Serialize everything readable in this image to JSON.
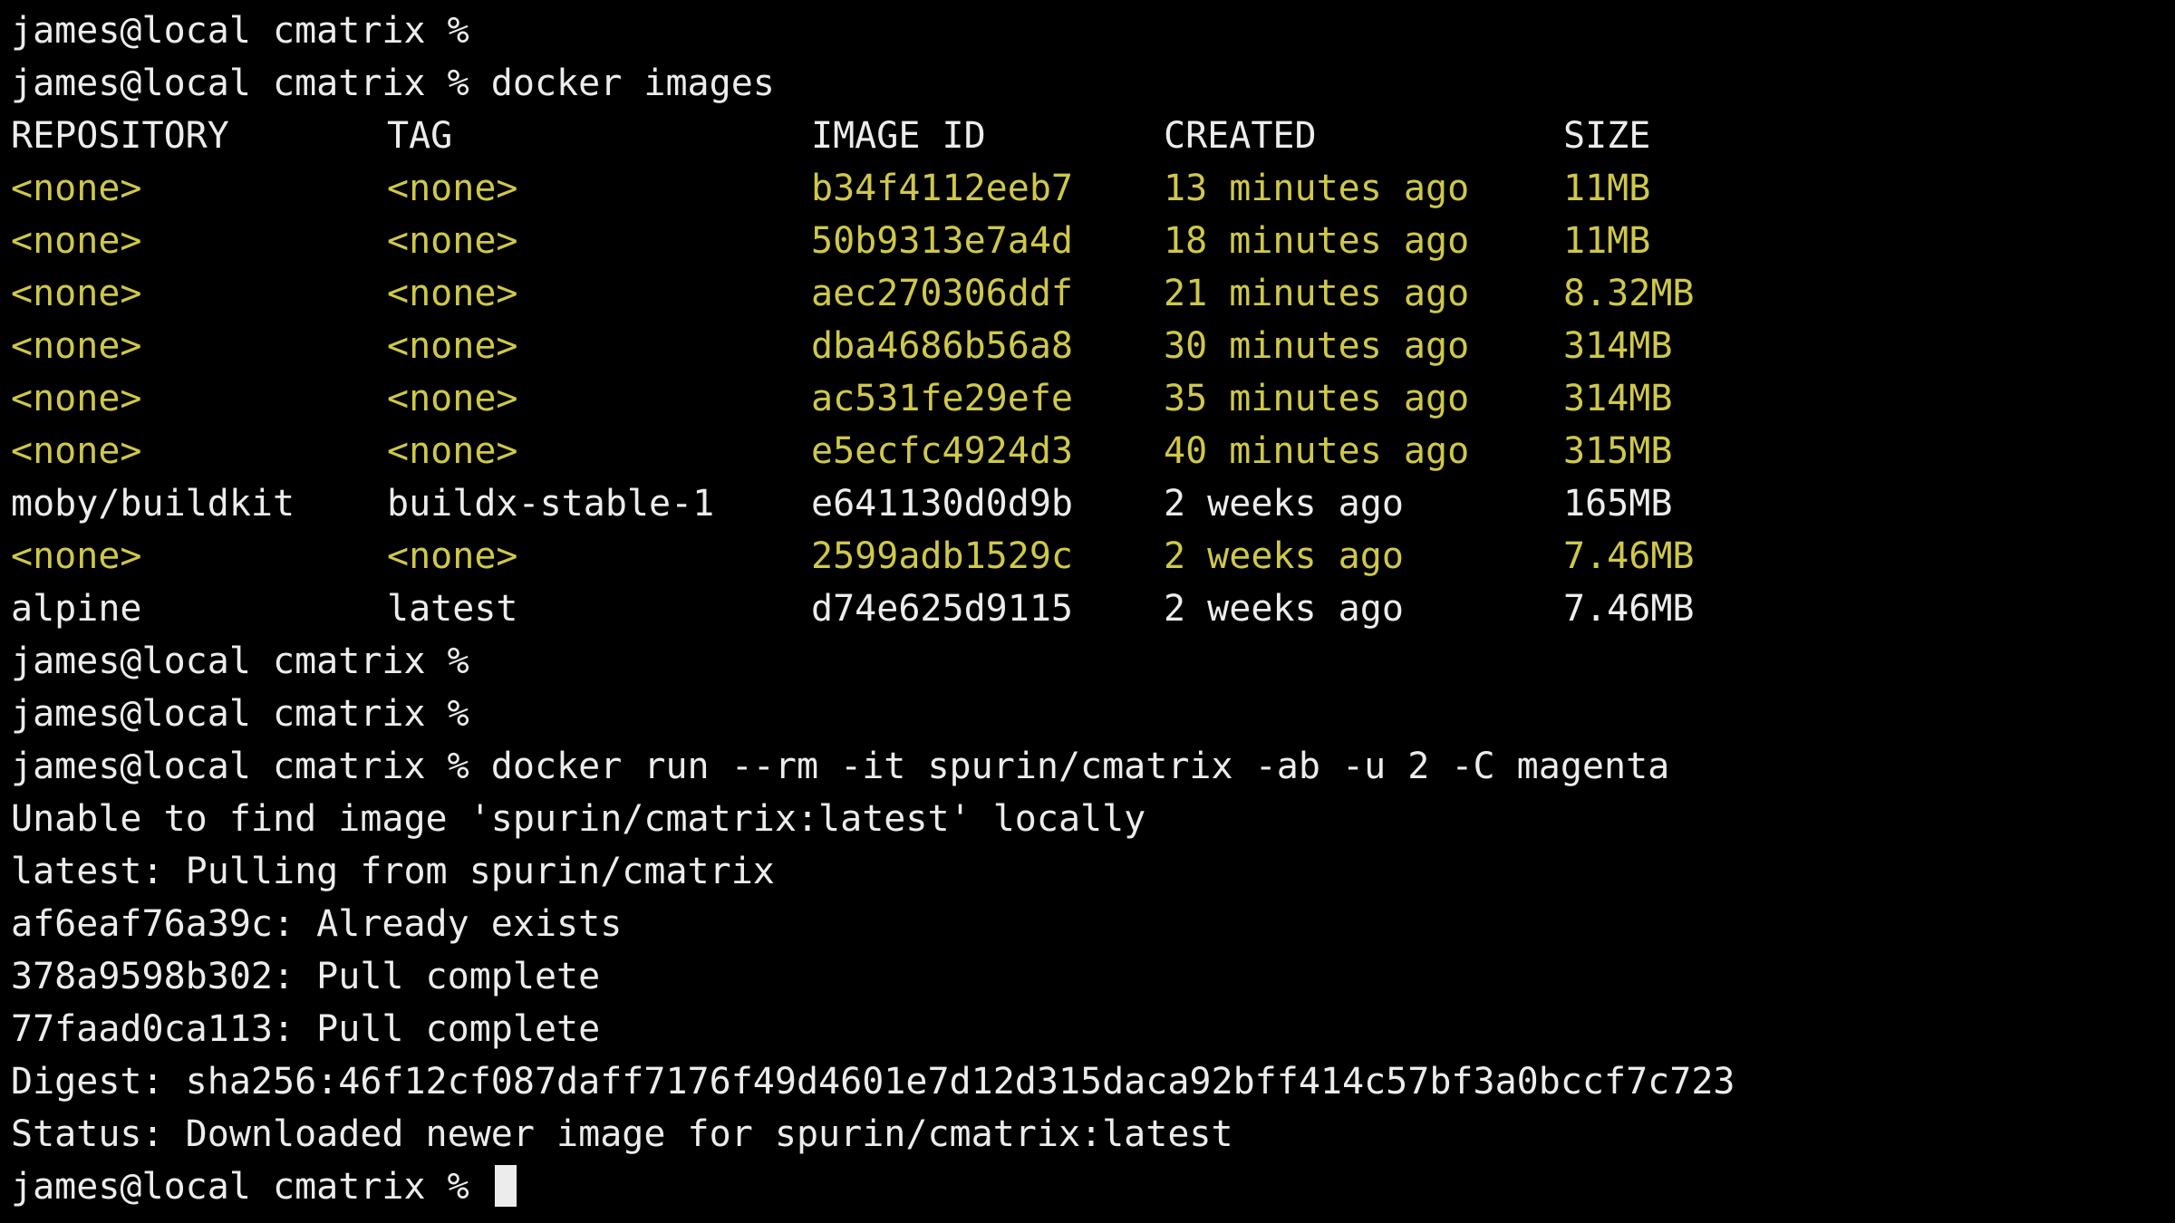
{
  "colors": {
    "background": "#000000",
    "text": "#ececec",
    "dangling_image": "#cfc84a"
  },
  "lines_before": [
    "james@local cmatrix %",
    "james@local cmatrix % docker images"
  ],
  "table": {
    "headers": [
      "REPOSITORY",
      "TAG",
      "IMAGE ID",
      "CREATED",
      "SIZE"
    ],
    "rows": [
      {
        "repository": "<none>",
        "tag": "<none>",
        "image_id": "b34f4112eeb7",
        "created": "13 minutes ago",
        "size": "11MB",
        "dangling": true
      },
      {
        "repository": "<none>",
        "tag": "<none>",
        "image_id": "50b9313e7a4d",
        "created": "18 minutes ago",
        "size": "11MB",
        "dangling": true
      },
      {
        "repository": "<none>",
        "tag": "<none>",
        "image_id": "aec270306ddf",
        "created": "21 minutes ago",
        "size": "8.32MB",
        "dangling": true
      },
      {
        "repository": "<none>",
        "tag": "<none>",
        "image_id": "dba4686b56a8",
        "created": "30 minutes ago",
        "size": "314MB",
        "dangling": true
      },
      {
        "repository": "<none>",
        "tag": "<none>",
        "image_id": "ac531fe29efe",
        "created": "35 minutes ago",
        "size": "314MB",
        "dangling": true
      },
      {
        "repository": "<none>",
        "tag": "<none>",
        "image_id": "e5ecfc4924d3",
        "created": "40 minutes ago",
        "size": "315MB",
        "dangling": true
      },
      {
        "repository": "moby/buildkit",
        "tag": "buildx-stable-1",
        "image_id": "e641130d0d9b",
        "created": "2 weeks ago",
        "size": "165MB",
        "dangling": false
      },
      {
        "repository": "<none>",
        "tag": "<none>",
        "image_id": "2599adb1529c",
        "created": "2 weeks ago",
        "size": "7.46MB",
        "dangling": true
      },
      {
        "repository": "alpine",
        "tag": "latest",
        "image_id": "d74e625d9115",
        "created": "2 weeks ago",
        "size": "7.46MB",
        "dangling": false
      }
    ]
  },
  "lines_after": [
    "james@local cmatrix %",
    "james@local cmatrix %",
    "james@local cmatrix % docker run --rm -it spurin/cmatrix -ab -u 2 -C magenta",
    "Unable to find image 'spurin/cmatrix:latest' locally",
    "latest: Pulling from spurin/cmatrix",
    "af6eaf76a39c: Already exists",
    "378a9598b302: Pull complete",
    "77faad0ca113: Pull complete",
    "Digest: sha256:46f12cf087daff7176f49d4601e7d12d315daca92bff414c57bf3a0bccf7c723",
    "Status: Downloaded newer image for spurin/cmatrix:latest"
  ],
  "current_prompt": "james@local cmatrix % "
}
